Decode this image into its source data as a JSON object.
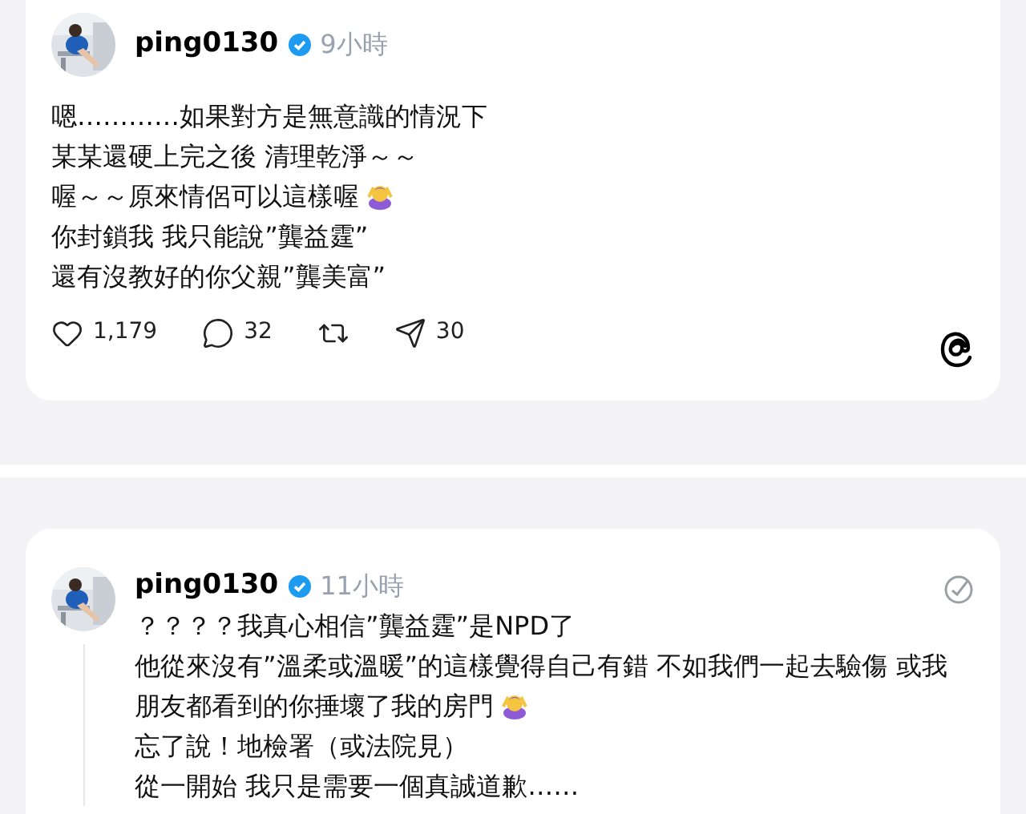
{
  "posts": [
    {
      "author": "ping0130",
      "verified": true,
      "time": "9小時",
      "lines": [
        {
          "text": "嗯…………如果對方是無意識的情況下",
          "emoji": false
        },
        {
          "text": "某某還硬上完之後 清理乾淨～～",
          "emoji": false
        },
        {
          "text": "喔～～原來情侶可以這樣喔",
          "emoji": true
        },
        {
          "text": "你封鎖我 我只能說”龔益霆”",
          "emoji": false
        },
        {
          "text": "還有沒教好的你父親”龔美富”",
          "emoji": false
        }
      ],
      "actions": [
        {
          "kind": "like",
          "count": "1,179"
        },
        {
          "kind": "reply",
          "count": "32"
        },
        {
          "kind": "repost"
        },
        {
          "kind": "share",
          "count": "30"
        }
      ]
    },
    {
      "author": "ping0130",
      "verified": true,
      "time": "11小時",
      "lines": [
        {
          "text": "？？？？我真心相信”龔益霆”是NPD了",
          "emoji": false
        },
        {
          "text": "他從來沒有”溫柔或溫暖”的這樣覺得自己有錯 不如我們一起去驗傷 或我",
          "emoji": false
        },
        {
          "text": "朋友都看到的你捶壞了我的房門",
          "emoji": true
        },
        {
          "text": "忘了說！地檢署（或法院見）",
          "emoji": false
        },
        {
          "text": "從一開始 我只是需要一個真誠道歉……",
          "emoji": false
        }
      ]
    }
  ]
}
